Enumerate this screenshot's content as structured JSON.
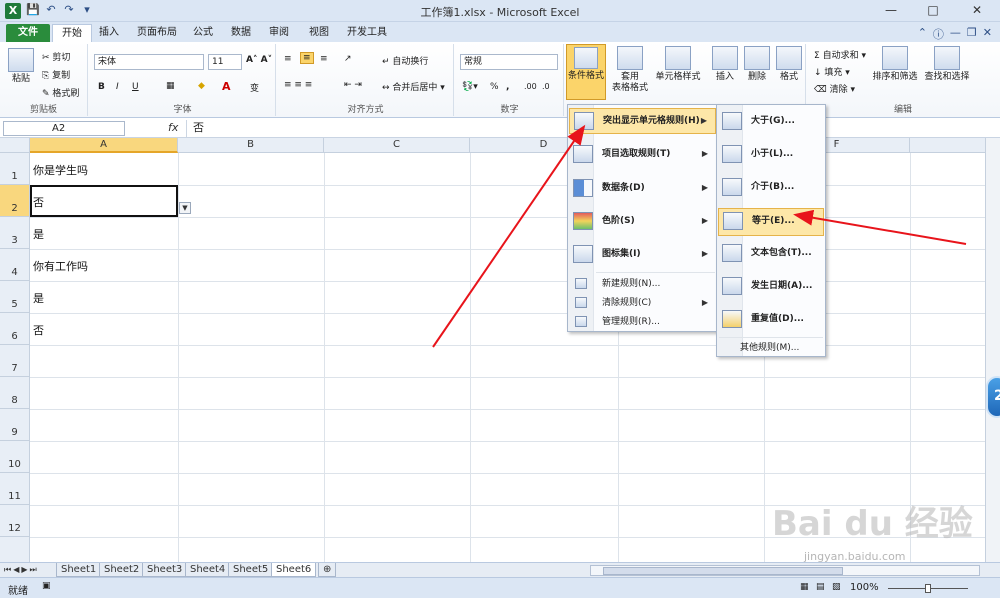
{
  "window": {
    "title": "工作簿1.xlsx - Microsoft Excel",
    "app_icon": "X"
  },
  "tabs": [
    "文件",
    "开始",
    "插入",
    "页面布局",
    "公式",
    "数据",
    "审阅",
    "视图",
    "开发工具"
  ],
  "ribbon": {
    "clipboard": {
      "paste": "粘贴",
      "cut": "剪切",
      "copy": "复制",
      "format_painter": "格式刷",
      "label": "剪贴板"
    },
    "font": {
      "name": "宋体",
      "size": "11",
      "bold": "B",
      "italic": "I",
      "underline": "U",
      "label": "字体",
      "font_color_glyph": "A",
      "phonetic": "变"
    },
    "alignment": {
      "wrap": "自动换行",
      "merge": "合并后居中",
      "label": "对齐方式"
    },
    "number": {
      "format": "常规",
      "percent": "%",
      "comma": ",",
      "label": "数字",
      "inc_decimal": ".00",
      "dec_decimal": ".0"
    },
    "styles": {
      "conditional": "条件格式",
      "table_format_1": "套用",
      "table_format_2": "表格格式",
      "cell_styles": "单元格样式"
    },
    "cells": {
      "insert": "插入",
      "delete": "删除",
      "format": "格式"
    },
    "editing": {
      "autosum": "自动求和",
      "fill": "填充",
      "clear": "清除",
      "sort": "排序和筛选",
      "find": "查找和选择",
      "label": "编辑"
    }
  },
  "formula_bar": {
    "name_box": "A2",
    "fx": "fx",
    "value": "否"
  },
  "columns": [
    "A",
    "B",
    "C",
    "D",
    "E",
    "F"
  ],
  "rows": [
    "1",
    "2",
    "3",
    "4",
    "5",
    "6",
    "7",
    "8",
    "9",
    "10",
    "11",
    "12"
  ],
  "cells": {
    "A1": "你是学生吗",
    "A2": "否",
    "A3": "是",
    "A4": "你有工作吗",
    "A5": "是",
    "A6": "否"
  },
  "cf_menu": {
    "items": [
      "突出显示单元格规则(H)",
      "项目选取规则(T)",
      "数据条(D)",
      "色阶(S)",
      "图标集(I)"
    ],
    "small_items": [
      "新建规则(N)...",
      "清除规则(C)",
      "管理规则(R)..."
    ]
  },
  "highlight_submenu": {
    "items": [
      "大于(G)...",
      "小于(L)...",
      "介于(B)...",
      "等于(E)...",
      "文本包含(T)...",
      "发生日期(A)...",
      "重复值(D)..."
    ],
    "more": "其他规则(M)..."
  },
  "sheets": [
    "Sheet1",
    "Sheet2",
    "Sheet3",
    "Sheet4",
    "Sheet5",
    "Sheet6"
  ],
  "active_sheet": "Sheet6",
  "status": {
    "ready": "就绪",
    "zoom": "100%"
  },
  "watermark": {
    "main": "Bai du 经验",
    "sub": "jingyan.baidu.com"
  },
  "side_badge": "2",
  "colors": {
    "file_tab": "#2a8c3c",
    "highlight": "#fde7a8",
    "annotation_arrow": "#e8141b"
  }
}
